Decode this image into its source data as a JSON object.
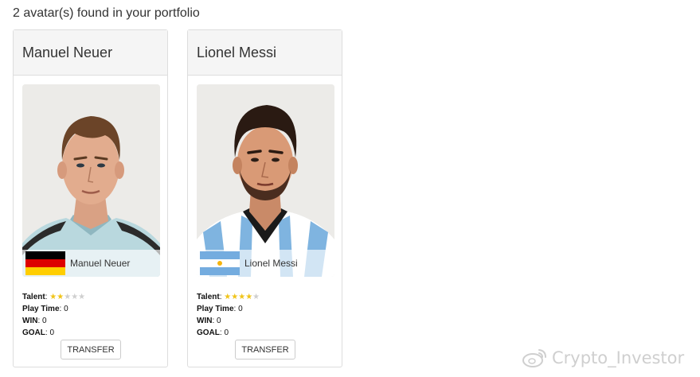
{
  "summary": "2 avatar(s) found in your portfolio",
  "cards": [
    {
      "name": "Manuel Neuer",
      "strip_name": "Manuel Neuer",
      "flag": "germany-flag",
      "talent_label": "Talent",
      "talent_stars": 2,
      "max_stars": 5,
      "stats": [
        {
          "label": "Play Time",
          "value": "0"
        },
        {
          "label": "WIN",
          "value": "0"
        },
        {
          "label": "GOAL",
          "value": "0"
        }
      ],
      "button": "TRANSFER"
    },
    {
      "name": "Lionel Messi",
      "strip_name": "Lionel Messi",
      "flag": "argentina-flag",
      "talent_label": "Talent",
      "talent_stars": 4,
      "max_stars": 5,
      "stats": [
        {
          "label": "Play Time",
          "value": "0"
        },
        {
          "label": "WIN",
          "value": "0"
        },
        {
          "label": "GOAL",
          "value": "0"
        }
      ],
      "button": "TRANSFER"
    }
  ],
  "watermark": "Crypto_Investor",
  "colors": {
    "star_on": "#f0c419",
    "star_off": "#cfcfcf",
    "header_bg": "#f5f5f5"
  }
}
